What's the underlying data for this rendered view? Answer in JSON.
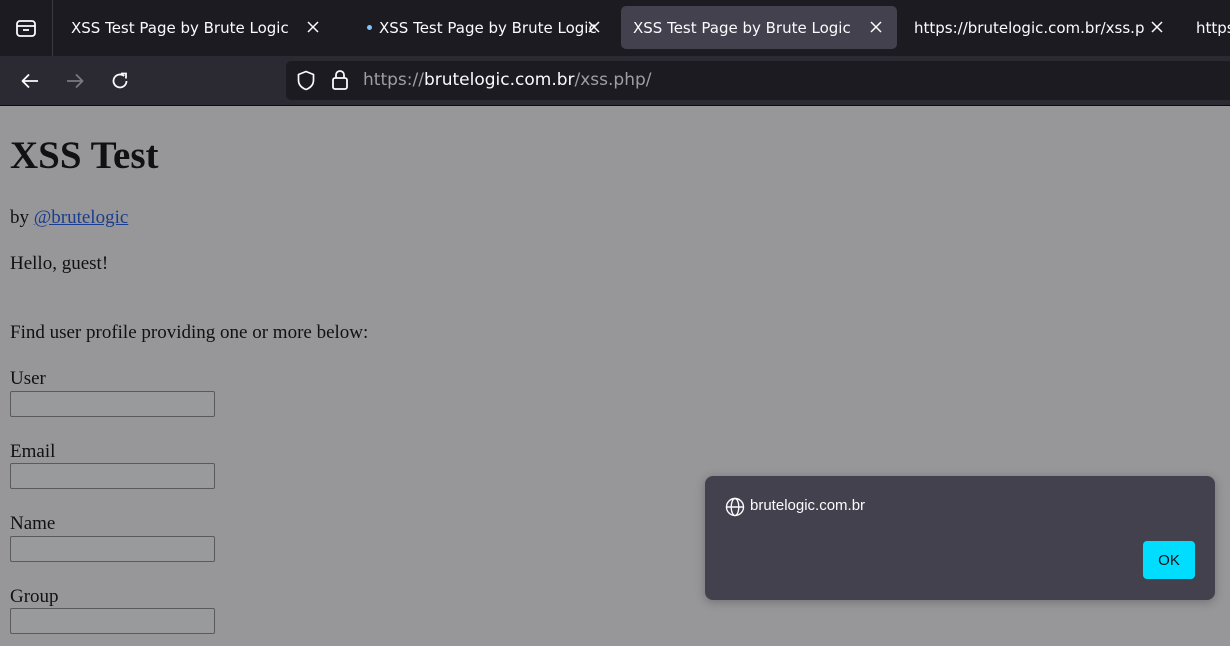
{
  "tabs": [
    {
      "title": "XSS Test Page by Brute Logic",
      "active": false,
      "dot": false
    },
    {
      "title": "XSS Test Page by Brute Logic",
      "active": false,
      "dot": true
    },
    {
      "title": "XSS Test Page by Brute Logic",
      "active": true,
      "dot": false
    },
    {
      "title": "https://brutelogic.com.br/xss.php/",
      "active": false,
      "dot": false
    },
    {
      "title": "https://brutelogic.com.br/xss.php/",
      "active": false,
      "dot": false
    }
  ],
  "urlbar": {
    "scheme": "https://",
    "host": "brutelogic.com.br",
    "path": "/xss.php/"
  },
  "page": {
    "title": "XSS Test",
    "by_prefix": "by",
    "author_link": "@brutelogic",
    "greeting": "Hello, guest!",
    "find_text": "Find user profile providing one or more below:",
    "fields": [
      {
        "label": "User",
        "value": ""
      },
      {
        "label": "Email",
        "value": ""
      },
      {
        "label": "Name",
        "value": ""
      },
      {
        "label": "Group",
        "value": ""
      }
    ]
  },
  "dialog": {
    "origin": "brutelogic.com.br",
    "ok_label": "OK"
  },
  "colors": {
    "accent": "#00ddff",
    "tabbar": "#1c1b22",
    "navbar": "#2b2a33",
    "dim_overlay": "#979799"
  }
}
